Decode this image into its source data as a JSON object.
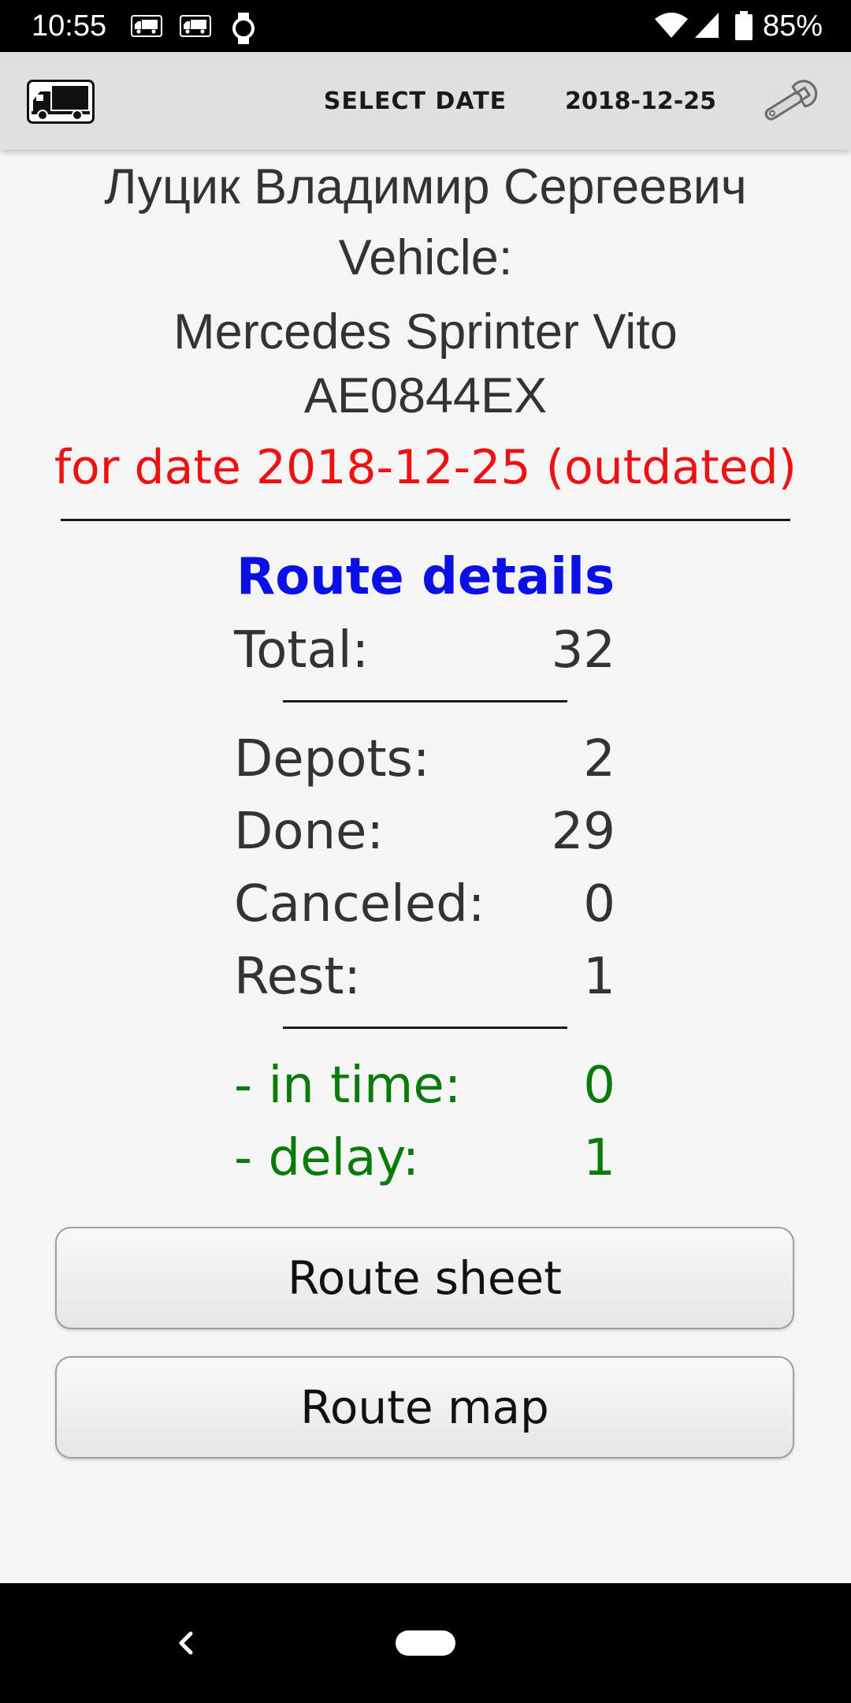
{
  "status_bar": {
    "time": "10:55",
    "battery_percent": "85%",
    "notification_icons": [
      "truck-notification-icon",
      "truck-notification-icon",
      "watch-icon"
    ],
    "system_icons": [
      "wifi-icon",
      "signal-icon",
      "battery-icon"
    ]
  },
  "toolbar": {
    "app_icon": "truck-icon",
    "select_date_label": "SELECT DATE",
    "current_date": "2018-12-25",
    "settings_icon": "wrench-icon"
  },
  "header": {
    "driver_name": "Луцик Владимир Сергеевич",
    "vehicle_label": "Vehicle:",
    "vehicle_name": "Mercedes Sprinter Vito",
    "vehicle_plate": "AE0844EX",
    "date_status": "for date 2018-12-25 (outdated)"
  },
  "route_details": {
    "title": "Route details",
    "total": {
      "label": "Total:",
      "value": "32"
    },
    "depots": {
      "label": "Depots:",
      "value": "2"
    },
    "done": {
      "label": "Done:",
      "value": "29"
    },
    "canceled": {
      "label": "Canceled:",
      "value": "0"
    },
    "rest": {
      "label": "Rest:",
      "value": "1"
    },
    "in_time": {
      "label": "- in time:",
      "value": "0"
    },
    "delay": {
      "label": "- delay:",
      "value": "1"
    }
  },
  "actions": {
    "route_sheet_label": "Route sheet",
    "route_map_label": "Route map"
  },
  "nav_bar": {
    "back_icon": "back-chevron-icon",
    "home_icon": "home-pill-icon"
  },
  "colors": {
    "status_bar_bg": "#000000",
    "toolbar_bg": "#e0e0e0",
    "page_bg": "#f5f5f5",
    "outdated_red": "#ee1111",
    "title_blue": "#0b10e6",
    "green": "#0a7a0a",
    "text": "#333333"
  }
}
